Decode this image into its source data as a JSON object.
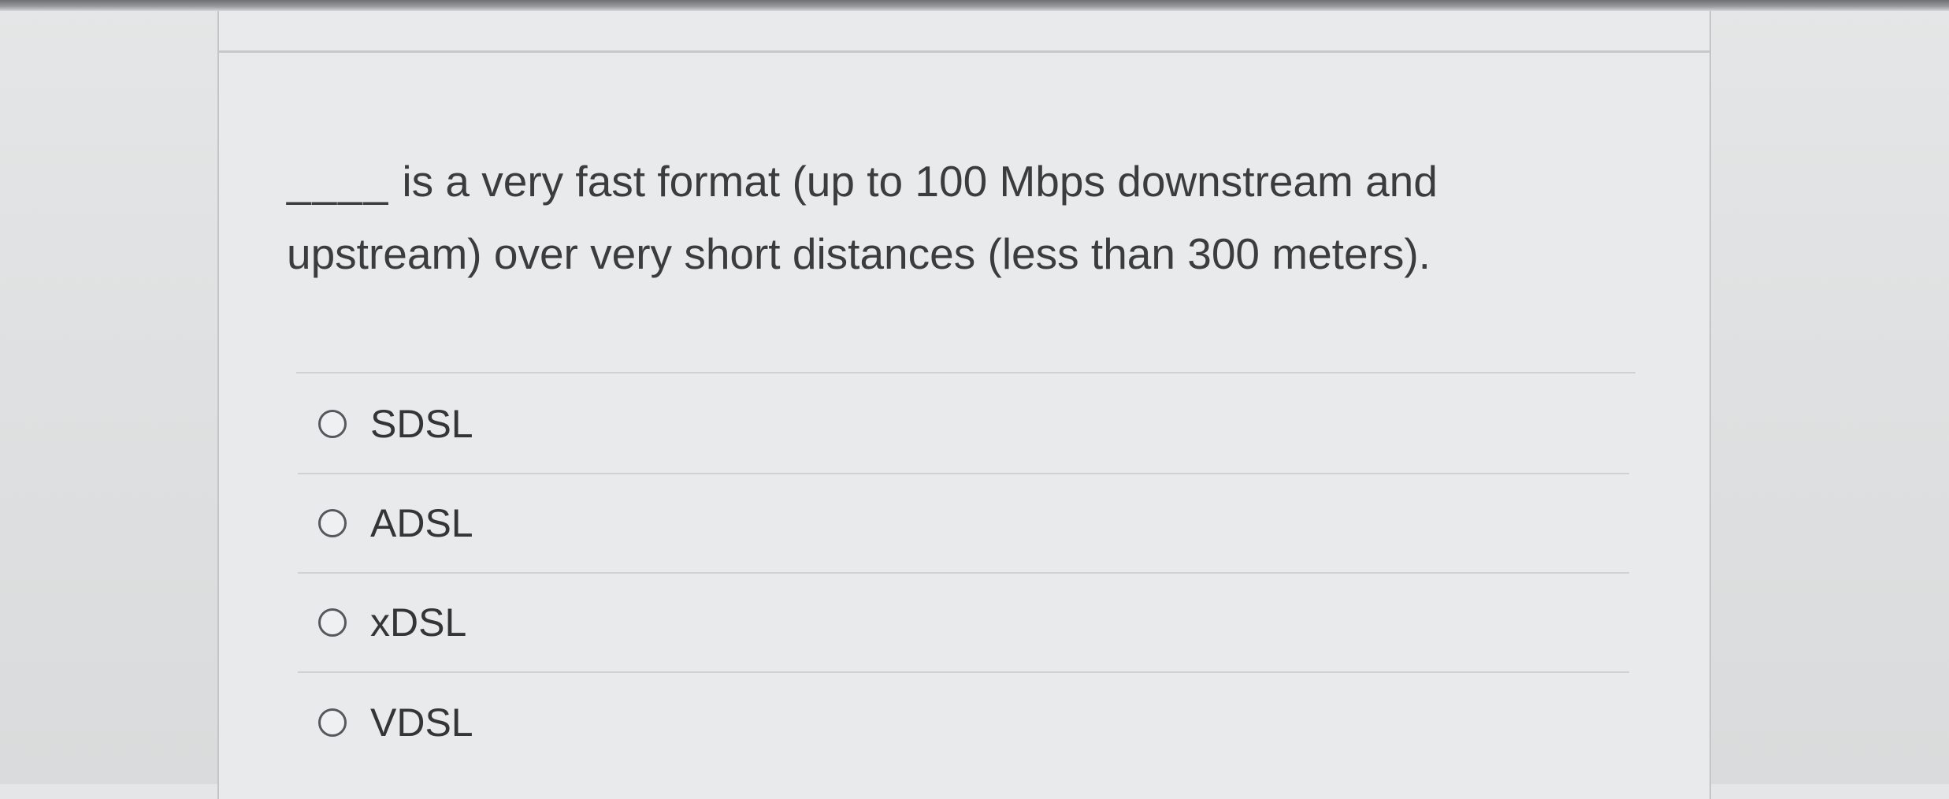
{
  "question": {
    "blank": "____",
    "text": "is a very fast format (up to 100 Mbps downstream and upstream) over very short distances (less than 300 meters)."
  },
  "options": [
    {
      "label": "SDSL"
    },
    {
      "label": "ADSL"
    },
    {
      "label": "xDSL"
    },
    {
      "label": "VDSL"
    }
  ]
}
